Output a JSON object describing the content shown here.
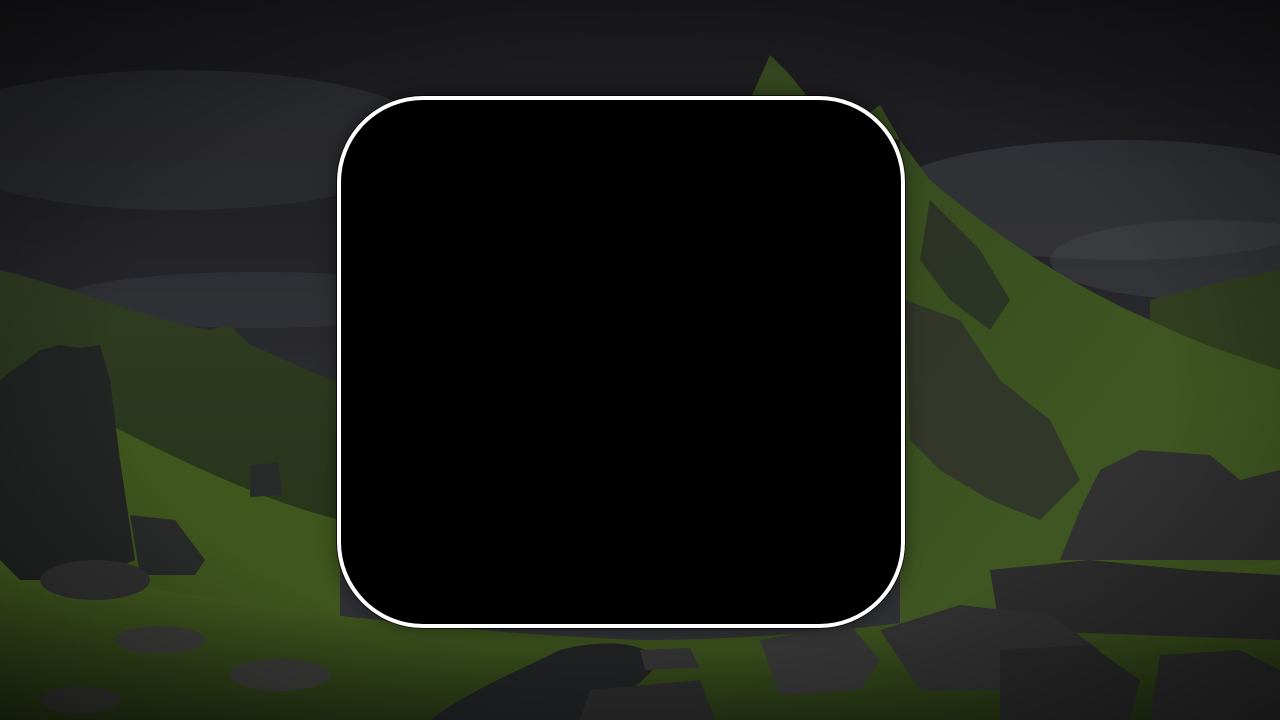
{
  "scene": {
    "location": "mountain-valley-background",
    "sky_color": "#2a2a2e",
    "grass_color": "#4f6a2a",
    "rock_color": "#3a3a3a"
  },
  "dialog": {
    "background_color": "#000000",
    "border_color": "#ffffff",
    "content_text": ""
  }
}
